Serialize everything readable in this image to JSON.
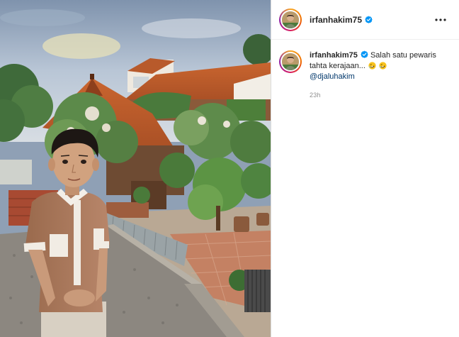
{
  "post": {
    "username": "irfanhakim75",
    "verified": true,
    "caption": {
      "text": "Salah satu pewaris tahta kerajaan...",
      "emojis": [
        "rolling-on-floor-laughing",
        "rolling-on-floor-laughing"
      ],
      "mention": "@djaluhakim",
      "timestamp": "23h"
    }
  },
  "icons": {
    "verified": "verified-badge-icon",
    "more": "more-options-icon"
  },
  "colors": {
    "verified_blue": "#0095f6",
    "mention_blue": "#00376b",
    "muted_text": "#8e8e8e",
    "primary_text": "#262626",
    "divider": "#dbdbdb"
  }
}
